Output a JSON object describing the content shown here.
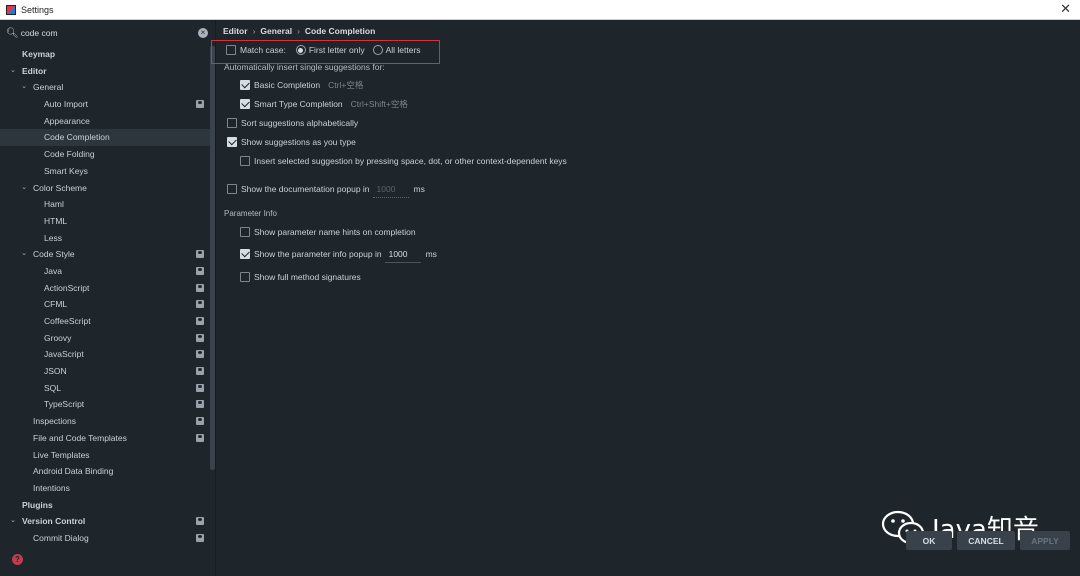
{
  "window": {
    "title": "Settings",
    "close_glyph": "✕"
  },
  "search": {
    "value": "code com",
    "icon": "search-icon",
    "clear_glyph": "×"
  },
  "sidebar": {
    "items": [
      {
        "label": "Keymap",
        "level": 1,
        "bold": true,
        "arrow": "",
        "badge": false
      },
      {
        "label": "Editor",
        "level": 1,
        "bold": true,
        "arrow": "⌄",
        "badge": false
      },
      {
        "label": "General",
        "level": 2,
        "bold": false,
        "arrow": "⌄",
        "badge": false
      },
      {
        "label": "Auto Import",
        "level": 3,
        "bold": false,
        "arrow": "",
        "badge": true
      },
      {
        "label": "Appearance",
        "level": 3,
        "bold": false,
        "arrow": "",
        "badge": false
      },
      {
        "label": "Code Completion",
        "level": 3,
        "bold": false,
        "arrow": "",
        "badge": false,
        "selected": true
      },
      {
        "label": "Code Folding",
        "level": 3,
        "bold": false,
        "arrow": "",
        "badge": false
      },
      {
        "label": "Smart Keys",
        "level": 3,
        "bold": false,
        "arrow": "",
        "badge": false
      },
      {
        "label": "Color Scheme",
        "level": 2,
        "bold": false,
        "arrow": "⌄",
        "badge": false
      },
      {
        "label": "Haml",
        "level": 3,
        "bold": false,
        "arrow": "",
        "badge": false
      },
      {
        "label": "HTML",
        "level": 3,
        "bold": false,
        "arrow": "",
        "badge": false
      },
      {
        "label": "Less",
        "level": 3,
        "bold": false,
        "arrow": "",
        "badge": false
      },
      {
        "label": "Code Style",
        "level": 2,
        "bold": false,
        "arrow": "⌄",
        "badge": true
      },
      {
        "label": "Java",
        "level": 3,
        "bold": false,
        "arrow": "",
        "badge": true
      },
      {
        "label": "ActionScript",
        "level": 3,
        "bold": false,
        "arrow": "",
        "badge": true
      },
      {
        "label": "CFML",
        "level": 3,
        "bold": false,
        "arrow": "",
        "badge": true
      },
      {
        "label": "CoffeeScript",
        "level": 3,
        "bold": false,
        "arrow": "",
        "badge": true
      },
      {
        "label": "Groovy",
        "level": 3,
        "bold": false,
        "arrow": "",
        "badge": true
      },
      {
        "label": "JavaScript",
        "level": 3,
        "bold": false,
        "arrow": "",
        "badge": true
      },
      {
        "label": "JSON",
        "level": 3,
        "bold": false,
        "arrow": "",
        "badge": true
      },
      {
        "label": "SQL",
        "level": 3,
        "bold": false,
        "arrow": "",
        "badge": true
      },
      {
        "label": "TypeScript",
        "level": 3,
        "bold": false,
        "arrow": "",
        "badge": true
      },
      {
        "label": "Inspections",
        "level": 2,
        "bold": false,
        "arrow": "",
        "badge": true
      },
      {
        "label": "File and Code Templates",
        "level": 2,
        "bold": false,
        "arrow": "",
        "badge": true
      },
      {
        "label": "Live Templates",
        "level": 2,
        "bold": false,
        "arrow": "",
        "badge": false
      },
      {
        "label": "Android Data Binding",
        "level": 2,
        "bold": false,
        "arrow": "",
        "badge": false
      },
      {
        "label": "Intentions",
        "level": 2,
        "bold": false,
        "arrow": "",
        "badge": false
      },
      {
        "label": "Plugins",
        "level": 1,
        "bold": true,
        "arrow": "",
        "badge": false
      },
      {
        "label": "Version Control",
        "level": 1,
        "bold": true,
        "arrow": "⌄",
        "badge": true
      },
      {
        "label": "Commit Dialog",
        "level": 2,
        "bold": false,
        "arrow": "",
        "badge": true
      }
    ]
  },
  "breadcrumb": {
    "items": [
      "Editor",
      "General",
      "Code Completion"
    ],
    "separator": "›"
  },
  "settings": {
    "match_case": {
      "label": "Match case:",
      "checked": false
    },
    "first_letter_only": {
      "label": "First letter only",
      "selected": true
    },
    "all_letters": {
      "label": "All letters",
      "selected": false
    },
    "auto_insert_header": "Automatically insert single suggestions for:",
    "basic_completion": {
      "label": "Basic Completion",
      "shortcut": "Ctrl+空格",
      "checked": true
    },
    "smart_type_completion": {
      "label": "Smart Type Completion",
      "shortcut": "Ctrl+Shift+空格",
      "checked": true
    },
    "sort_alpha": {
      "label": "Sort suggestions alphabetically",
      "checked": false
    },
    "show_as_you_type": {
      "label": "Show suggestions as you type",
      "checked": true
    },
    "insert_selected": {
      "label": "Insert selected suggestion by pressing space, dot, or other context-dependent keys",
      "checked": false
    },
    "doc_popup": {
      "label": "Show the documentation popup in",
      "value": "1000",
      "unit": "ms",
      "checked": false
    },
    "param_info_header": "Parameter Info",
    "param_hints": {
      "label": "Show parameter name hints on completion",
      "checked": false
    },
    "param_popup": {
      "label": "Show the parameter info popup in",
      "value": "1000",
      "unit": "ms",
      "checked": true
    },
    "full_signatures": {
      "label": "Show full method signatures",
      "checked": false
    }
  },
  "buttons": {
    "ok": "OK",
    "cancel": "CANCEL",
    "apply": "APPLY"
  },
  "help": {
    "glyph": "?"
  },
  "watermark": {
    "text": "Java知音"
  },
  "colors": {
    "background": "#1e252b",
    "highlight_box": "#d4313b",
    "selected_row": "#2d353d"
  }
}
